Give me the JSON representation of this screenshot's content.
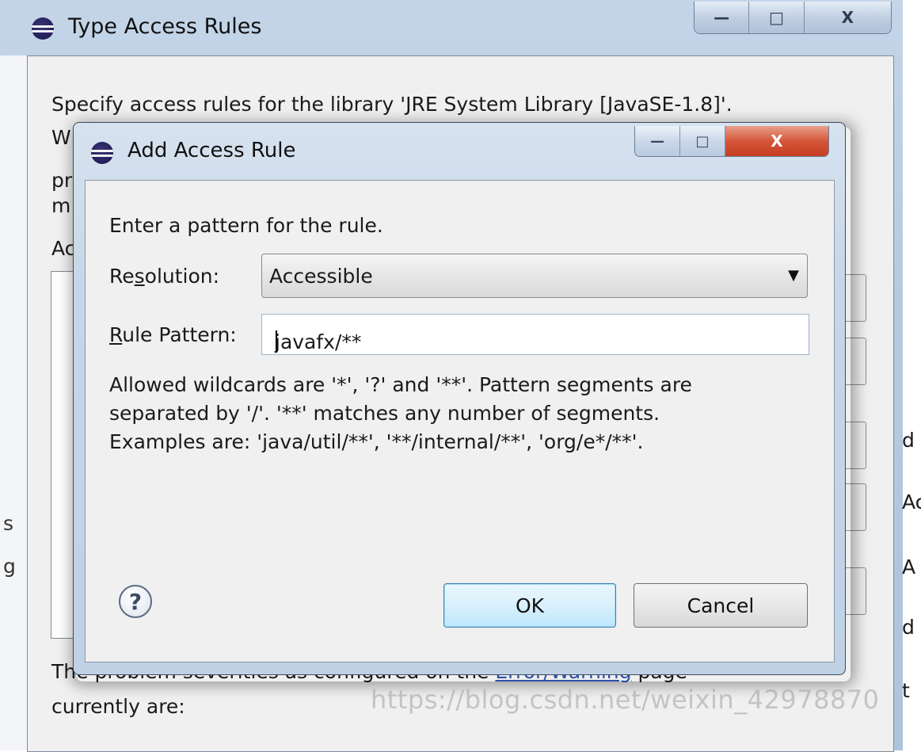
{
  "outer_window": {
    "title": "Type Access Rules",
    "controls": {
      "minimize": "—",
      "maximize": "□",
      "close": "X"
    },
    "description": "Specify access rules for the library 'JRE System Library [JavaSE-1.8]'.",
    "fragments": {
      "line2": "W",
      "line3": "pr",
      "line4": "m",
      "label": "Ac"
    },
    "right_fragments": [
      "d",
      "Ac",
      "A",
      "d",
      "t"
    ],
    "left_fragments": [
      "s",
      "g"
    ],
    "footer_line1": "The problem severities as configured on the",
    "footer_link": "Error/Warning",
    "footer_line1_end": "page",
    "footer_line2": "currently are:"
  },
  "watermark": "https://blog.csdn.net/weixin_42978870",
  "dialog": {
    "title": "Add Access Rule",
    "controls": {
      "minimize": "—",
      "maximize": "□",
      "close": "X"
    },
    "prompt": "Enter a pattern for the rule.",
    "resolution": {
      "label_pre": "Re",
      "label_mnemonic": "s",
      "label_post": "olution:",
      "value": "Accessible"
    },
    "rule_pattern": {
      "label_mnemonic": "R",
      "label_post": "ule Pattern:",
      "value": "javafx/**"
    },
    "help_lines": [
      "Allowed wildcards are '*', '?' and '**'. Pattern segments are",
      "separated by '/'. '**' matches any number of segments.",
      "Examples are: 'java/util/**', '**/internal/**', 'org/e*/**'."
    ],
    "help_icon": "?",
    "ok_label": "OK",
    "cancel_label": "Cancel"
  }
}
